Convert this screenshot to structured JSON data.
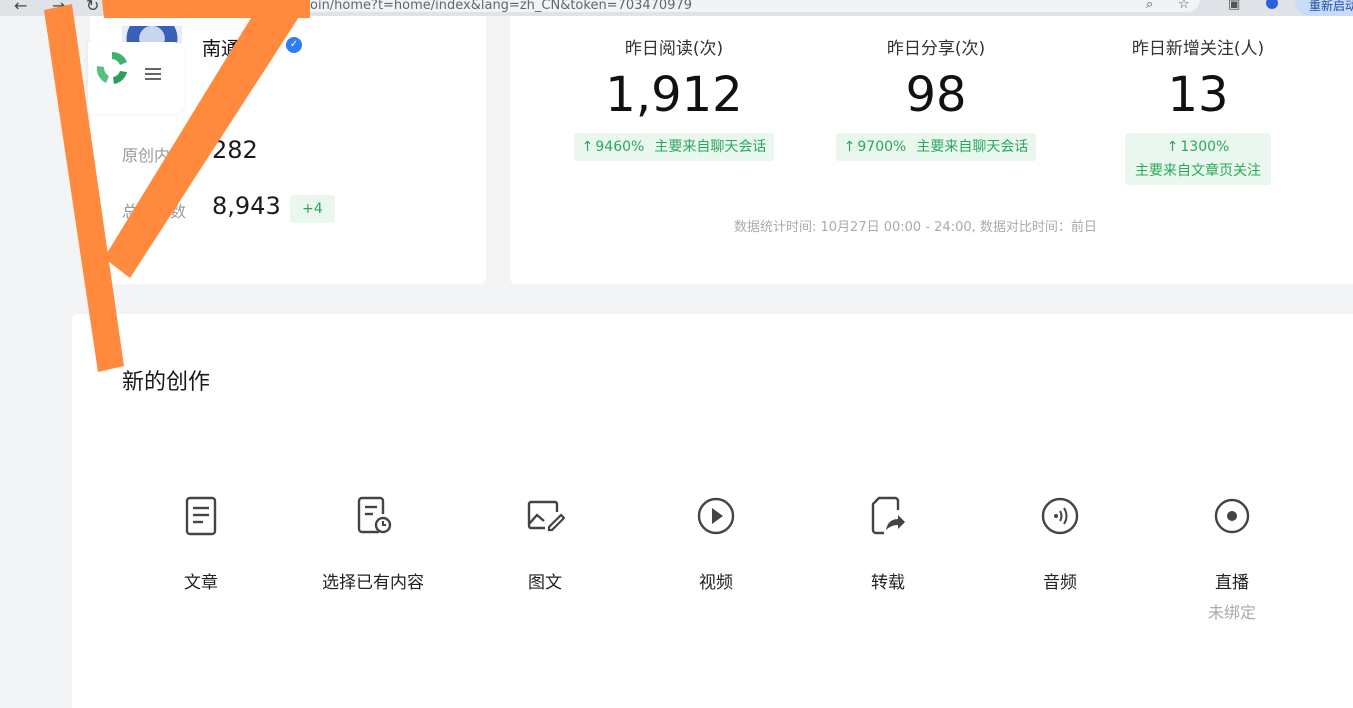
{
  "browser": {
    "url": "oin/home?t=home/index&lang=zh_CN&token=703470979",
    "relaunch_label": "重新启动"
  },
  "account": {
    "name": "南通工",
    "stats": [
      {
        "label": "原创内容",
        "value": "282"
      },
      {
        "label": "总用户数",
        "value": "8,943",
        "delta": "+4"
      }
    ]
  },
  "yesterday": {
    "metrics": [
      {
        "title": "昨日阅读(次)",
        "value": "1,912",
        "change": "9460%",
        "source": "主要来自聊天会话"
      },
      {
        "title": "昨日分享(次)",
        "value": "98",
        "change": "9700%",
        "source": "主要来自聊天会话"
      },
      {
        "title": "昨日新增关注(人)",
        "value": "13",
        "change": "1300%",
        "source": "主要来自文章页关注"
      }
    ],
    "footnote": "数据统计时间: 10月27日 00:00 - 24:00, 数据对比时间：前日"
  },
  "creation": {
    "title": "新的创作",
    "items": [
      {
        "label": "文章",
        "icon": "article-icon"
      },
      {
        "label": "选择已有内容",
        "icon": "existing-content-icon"
      },
      {
        "label": "图文",
        "icon": "image-text-icon"
      },
      {
        "label": "视频",
        "icon": "video-icon"
      },
      {
        "label": "转载",
        "icon": "repost-icon"
      },
      {
        "label": "音频",
        "icon": "audio-icon"
      },
      {
        "label": "直播",
        "icon": "live-icon",
        "sub": "未绑定"
      }
    ]
  },
  "colors": {
    "accent_green": "#2aa85a",
    "annotation_orange": "#ff8a3d",
    "verified_blue": "#2f7df6"
  }
}
